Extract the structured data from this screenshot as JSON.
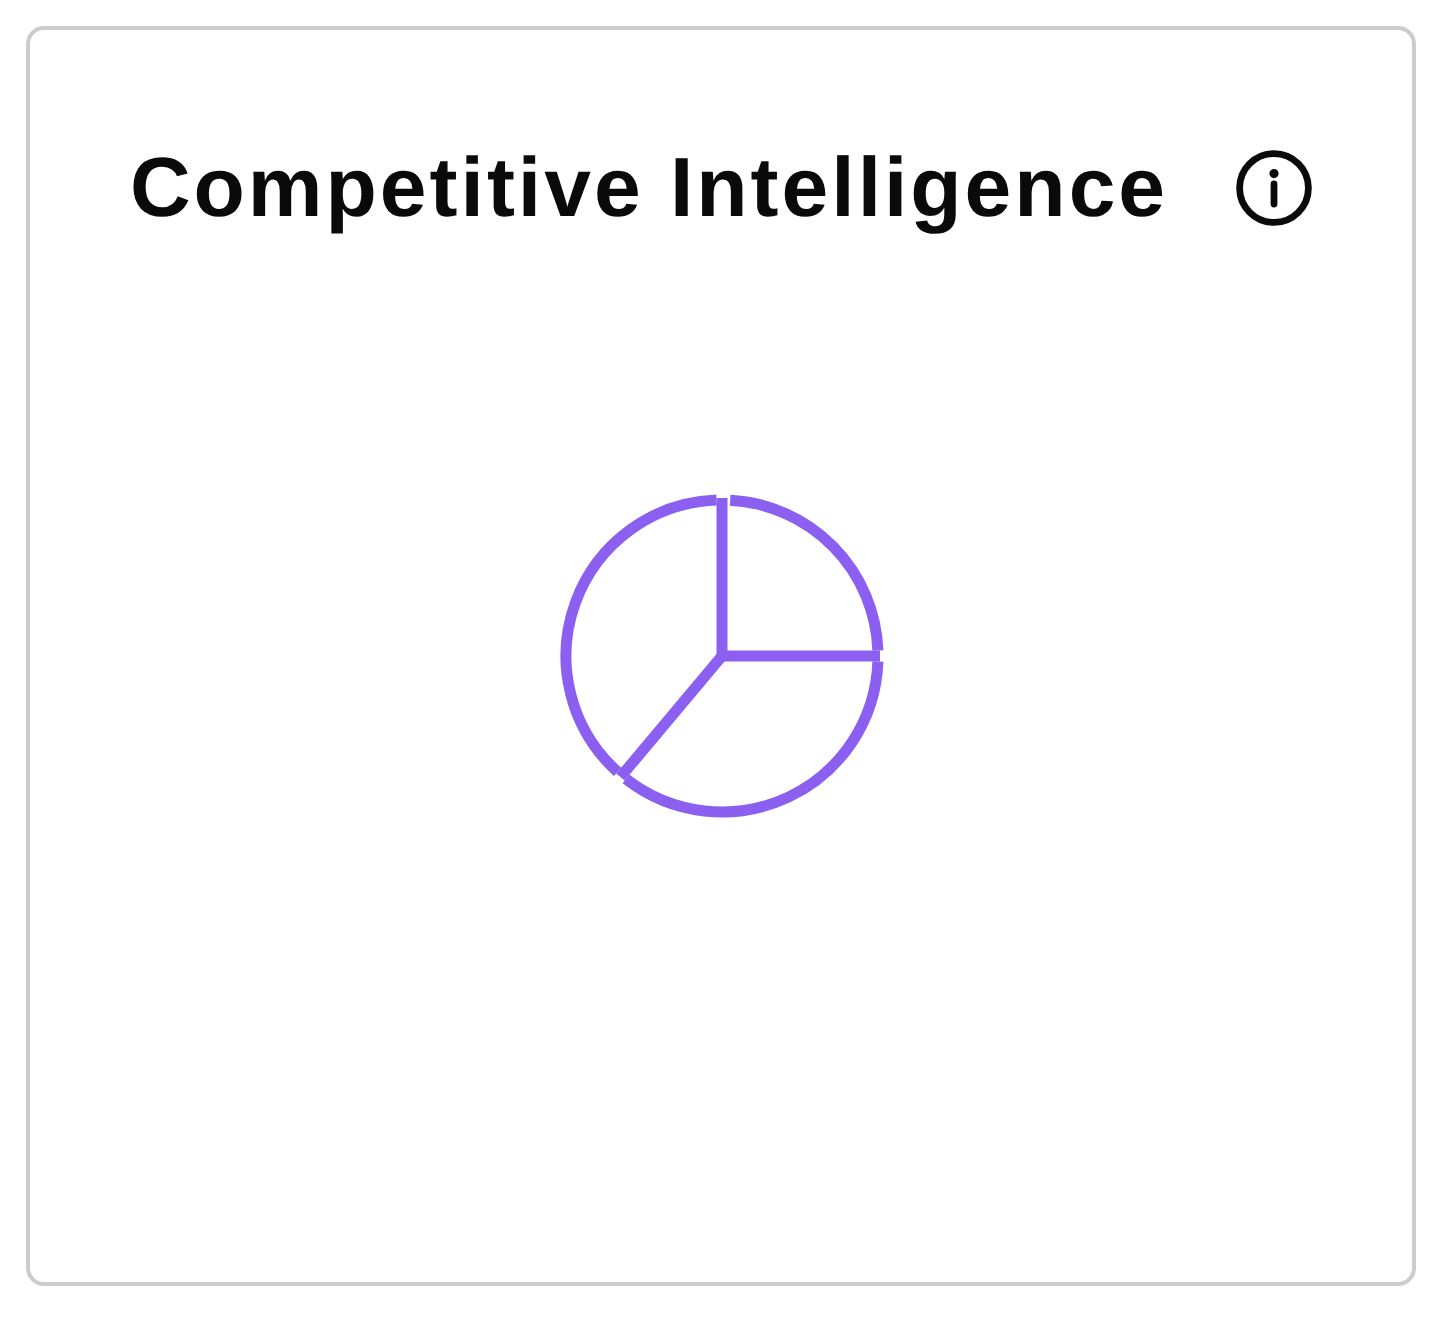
{
  "card": {
    "title": "Competitive Intelligence"
  }
}
